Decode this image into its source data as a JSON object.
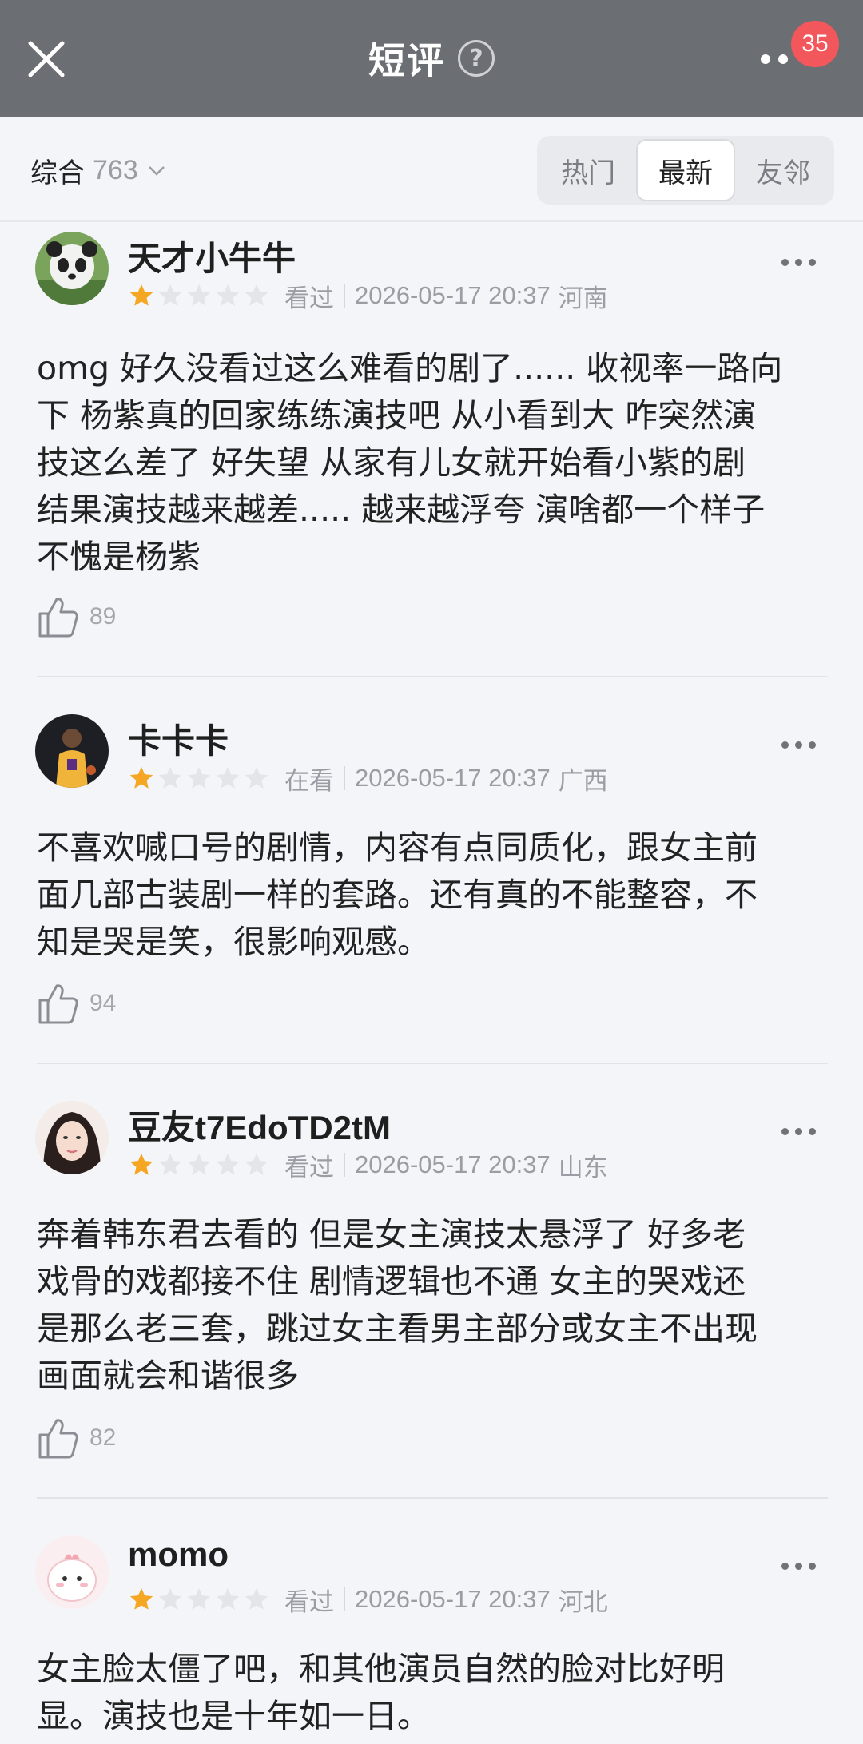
{
  "header": {
    "title": "短评",
    "help_symbol": "?",
    "notification_count": "35",
    "close_icon": "close-icon",
    "more_icon": "more-dots-icon"
  },
  "filter": {
    "sort_label": "综合",
    "total_count": "763",
    "tabs": [
      {
        "label": "热门",
        "active": false
      },
      {
        "label": "最新",
        "active": true
      },
      {
        "label": "友邻",
        "active": false
      }
    ]
  },
  "colors": {
    "header_bg": "#6b6e72",
    "badge": "#f2575b",
    "star_filled": "#f5a623",
    "star_empty": "#e3e5e8"
  },
  "reviews": [
    {
      "user": "天才小牛牛",
      "rating": 1,
      "status": "看过",
      "time": "2026-05-17 20:37",
      "location": "河南",
      "text": "omg 好久没看过这么难看的剧了...... 收视率一路向\n下 杨紫真的回家练练演技吧 从小看到大 咋突然演\n技这么差了 好失望 从家有儿女就开始看小紫的剧\n结果演技越来越差..... 越来越浮夸 演啥都一个样子\n不愧是杨紫",
      "likes": "89"
    },
    {
      "user": "卡卡卡",
      "rating": 1,
      "status": "在看",
      "time": "2026-05-17 20:37",
      "location": "广西",
      "text": "不喜欢喊口号的剧情，内容有点同质化，跟女主前\n面几部古装剧一样的套路。还有真的不能整容，不\n知是哭是笑，很影响观感。",
      "likes": "94"
    },
    {
      "user": "豆友t7EdoTD2tM",
      "rating": 1,
      "status": "看过",
      "time": "2026-05-17 20:37",
      "location": "山东",
      "text": "奔着韩东君去看的 但是女主演技太悬浮了 好多老\n戏骨的戏都接不住 剧情逻辑也不通 女主的哭戏还\n是那么老三套，跳过女主看男主部分或女主不出现\n画面就会和谐很多",
      "likes": "82"
    },
    {
      "user": "momo",
      "rating": 1,
      "status": "看过",
      "time": "2026-05-17 20:37",
      "location": "河北",
      "text": "女主脸太僵了吧，和其他演员自然的脸对比好明\n显。演技也是十年如一日。",
      "likes": ""
    }
  ]
}
